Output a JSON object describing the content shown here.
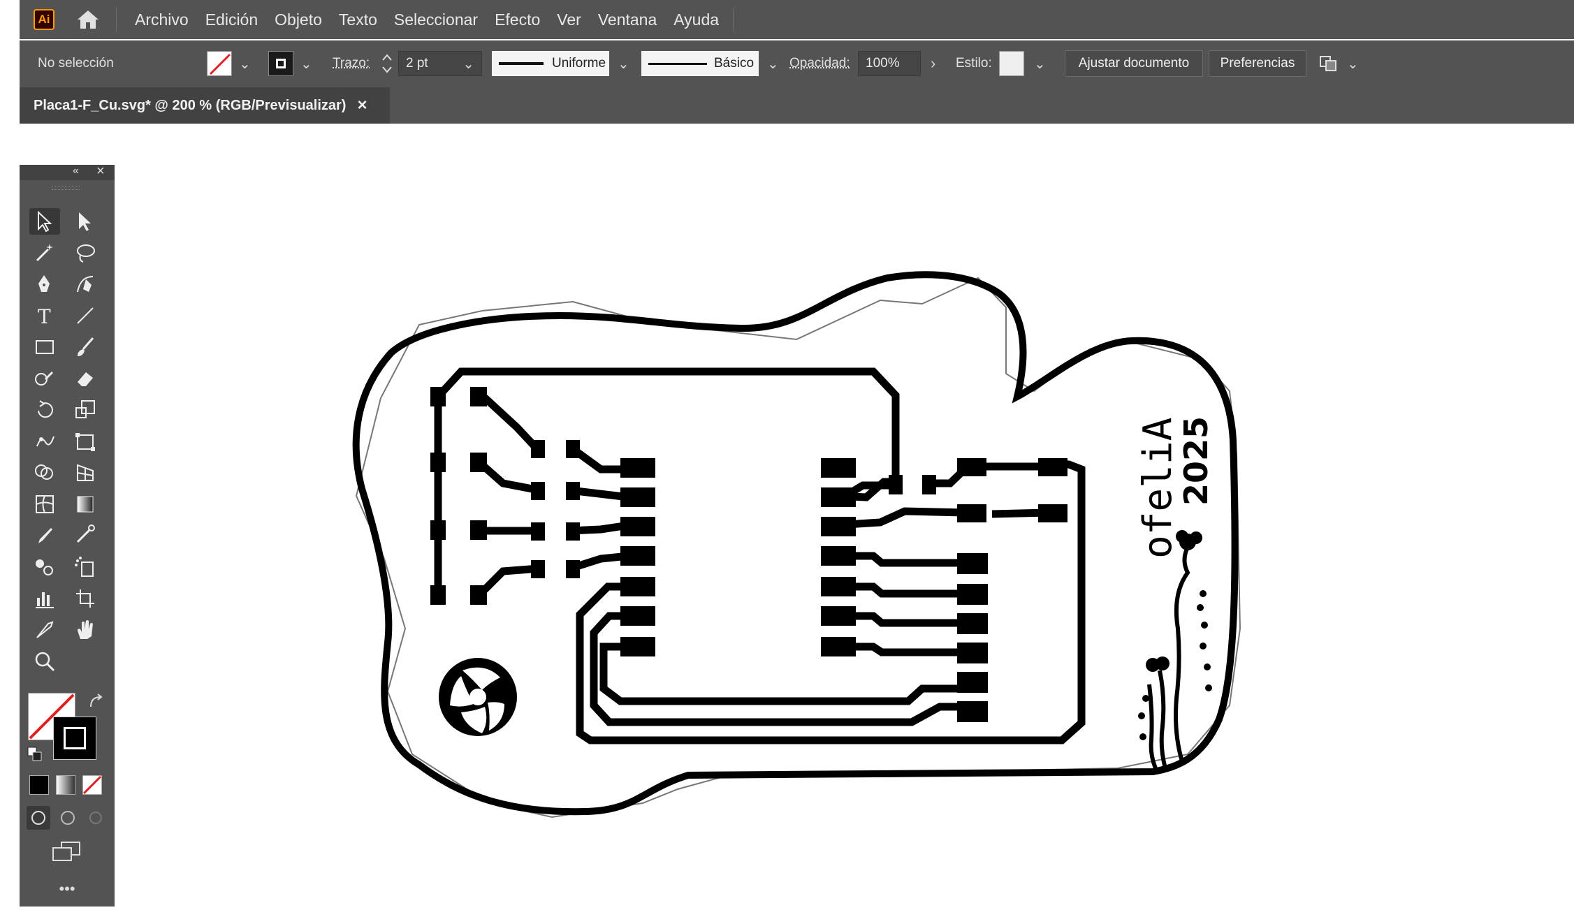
{
  "app": {
    "logo_text": "Ai",
    "brand_color": "#ff9a00"
  },
  "menu": [
    "Archivo",
    "Edición",
    "Objeto",
    "Texto",
    "Seleccionar",
    "Efecto",
    "Ver",
    "Ventana",
    "Ayuda"
  ],
  "control_bar": {
    "selection_status": "No selección",
    "stroke_label": "Trazo:",
    "stroke_weight": "2 pt",
    "stroke_profile": "Uniforme",
    "brush": "Básico",
    "opacity_label": "Opacidad:",
    "opacity_value": "100%",
    "style_label": "Estilo:",
    "document_setup_button": "Ajustar documento",
    "preferences_button": "Preferencias"
  },
  "document_tab": {
    "title": "Placa1-F_Cu.svg* @ 200 % (RGB/Previsualizar)",
    "close": "×"
  },
  "artwork": {
    "name_text": "ofeliA",
    "year_text": "2025"
  },
  "tools": {
    "icons": [
      "selection-tool",
      "direct-selection-tool",
      "magic-wand-tool",
      "lasso-tool",
      "pen-tool",
      "curvature-tool",
      "type-tool",
      "line-tool",
      "rectangle-tool",
      "paintbrush-tool",
      "shaper-tool",
      "eraser-tool",
      "rotate-tool",
      "scale-tool",
      "puppet-warp-tool",
      "free-transform-tool",
      "shape-builder-tool",
      "perspective-grid-tool",
      "mesh-tool",
      "gradient-tool",
      "eyedropper-tool",
      "measure-tool",
      "blend-tool",
      "symbol-sprayer-tool",
      "graph-tool",
      "artboard-tool",
      "slice-tool",
      "hand-tool",
      "zoom-tool"
    ],
    "more": "•••"
  }
}
